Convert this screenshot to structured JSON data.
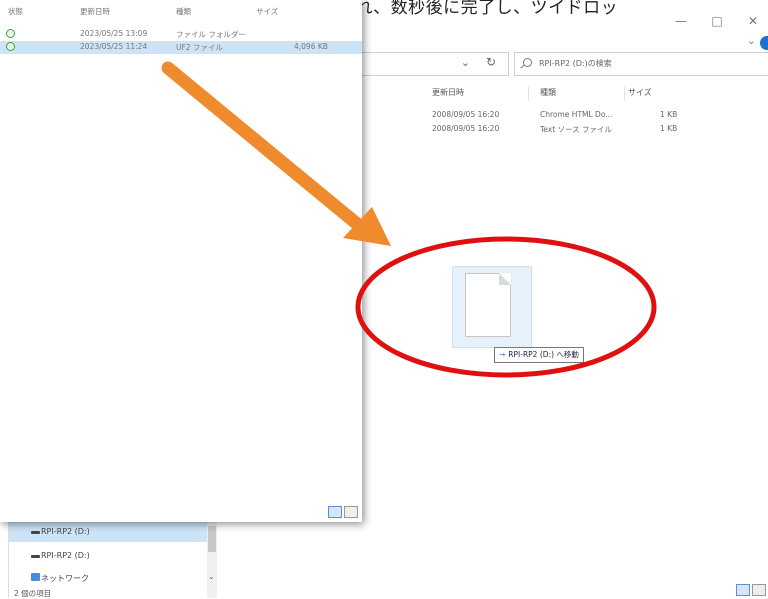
{
  "caption": "書を選の下を示すツイドロッが表示され、数秒後に完了し、ツイドロッ",
  "popup": {
    "headers": {
      "status": "状態",
      "modified": "更新日時",
      "type": "種類",
      "size": "サイズ"
    },
    "rows": [
      {
        "modified": "2023/05/25 13:09",
        "type": "ファイル フォルダー",
        "size": ""
      },
      {
        "modified": "2023/05/25 11:24",
        "type": "UF2 ファイル",
        "size": "4,096 KB"
      }
    ]
  },
  "explorer": {
    "window_controls": {
      "minimize": "—",
      "maximize": "□",
      "close": "✕"
    },
    "search_placeholder": "RPI-RP2 (D:)の検索",
    "columns": {
      "modified": "更新日時",
      "type": "種類",
      "size": "サイズ"
    },
    "files": [
      {
        "modified": "2008/09/05 16:20",
        "type": "Chrome HTML Do...",
        "size": "1 KB"
      },
      {
        "modified": "2008/09/05 16:20",
        "type": "Text ソース ファイル",
        "size": "1 KB"
      }
    ],
    "nav_items": [
      {
        "label": "RPI-RP2 (D:)",
        "icon": "drive-icon",
        "selected": true
      },
      {
        "label": "RPI-RP2 (D:)",
        "icon": "drive-icon",
        "selected": false
      },
      {
        "label": "ネットワーク",
        "icon": "network-icon",
        "selected": false
      }
    ],
    "status_count": "2 個の項目"
  },
  "drag": {
    "tooltip": "RPI-RP2 (D:) へ移動"
  },
  "colors": {
    "arrow": "#ef8a2d",
    "circle": "#e01010",
    "selection": "#cde4f7",
    "accent": "#1f6fd1"
  }
}
